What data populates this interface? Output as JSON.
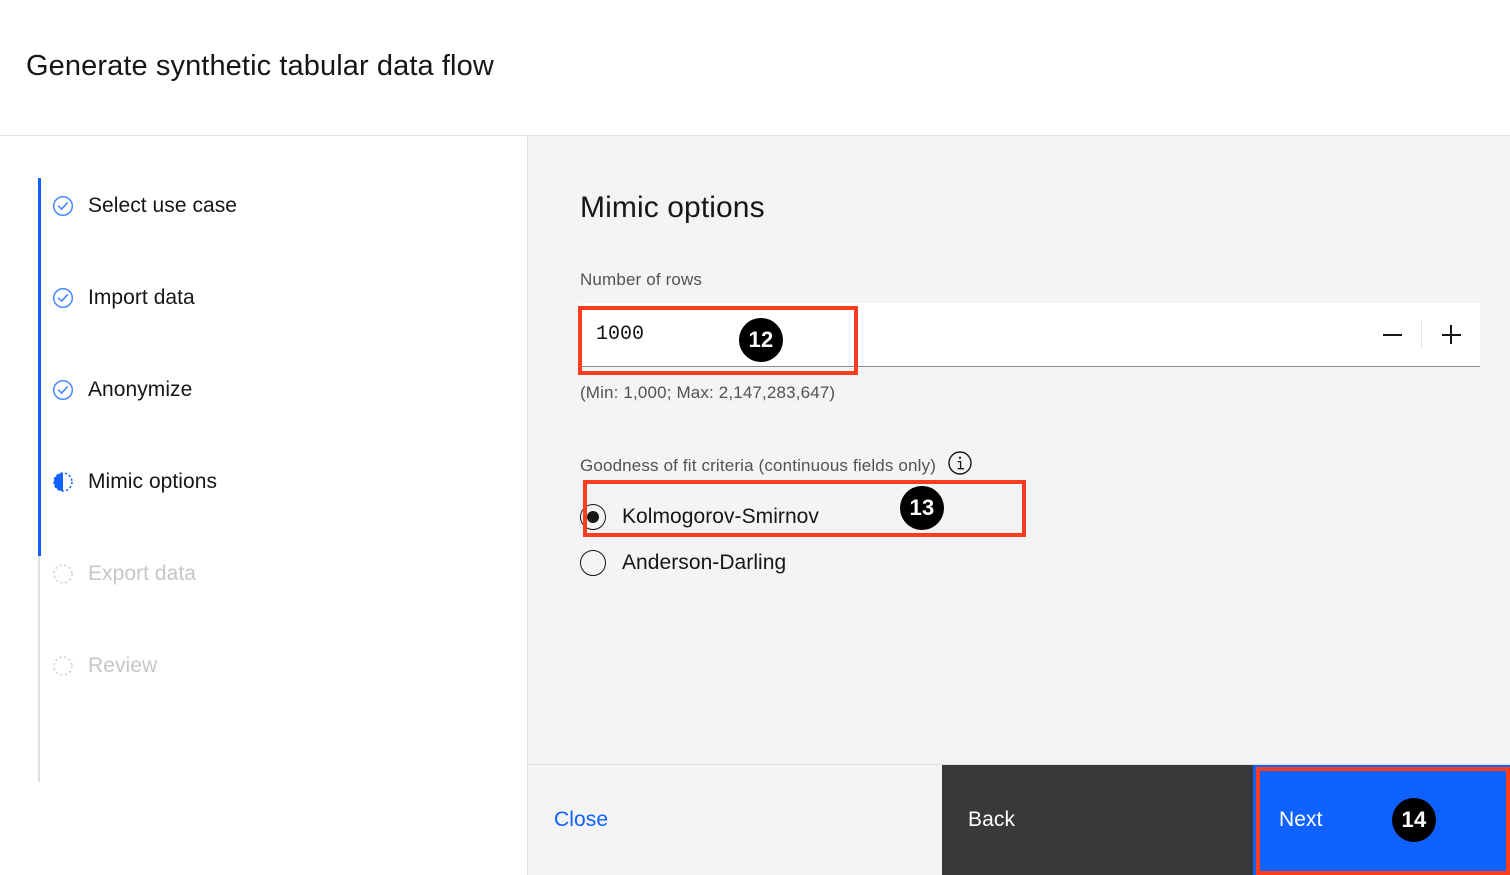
{
  "header": {
    "title": "Generate synthetic tabular data flow"
  },
  "sidebar": {
    "steps": [
      {
        "label": "Select use case",
        "state": "complete",
        "icon": "check-circle-icon"
      },
      {
        "label": "Import data",
        "state": "complete",
        "icon": "check-circle-icon"
      },
      {
        "label": "Anonymize",
        "state": "complete",
        "icon": "check-circle-icon"
      },
      {
        "label": "Mimic options",
        "state": "current",
        "icon": "half-filled-circle-icon"
      },
      {
        "label": "Export data",
        "state": "disabled",
        "icon": "dashed-circle-icon"
      },
      {
        "label": "Review",
        "state": "disabled",
        "icon": "dashed-circle-icon"
      }
    ]
  },
  "main": {
    "section_title": "Mimic options",
    "number_of_rows": {
      "label": "Number of rows",
      "value": "1000",
      "placeholder": "",
      "helper_text": "(Min: 1,000; Max: 2,147,283,647)",
      "decrement_icon": "minus-icon",
      "increment_icon": "plus-icon"
    },
    "goodness_of_fit": {
      "legend": "Goodness of fit criteria (continuous fields only)",
      "info_icon": "information-icon",
      "selected": "Kolmogorov-Smirnov",
      "options": [
        {
          "label": "Kolmogorov-Smirnov",
          "checked": true
        },
        {
          "label": "Anderson-Darling",
          "checked": false
        }
      ]
    }
  },
  "footer": {
    "close_label": "Close",
    "back_label": "Back",
    "next_label": "Next"
  },
  "annotations": [
    {
      "number": "12",
      "target": "number-of-rows-input"
    },
    {
      "number": "13",
      "target": "radio-kolmogorov-smirnov"
    },
    {
      "number": "14",
      "target": "next-button"
    }
  ],
  "colors": {
    "accent_blue": "#0f62fe",
    "annotation_red": "#f93d1e",
    "back_dark": "#393939",
    "panel_gray": "#f4f4f4",
    "text_primary": "#161616",
    "text_secondary": "#525252",
    "text_disabled": "#c6c6c6"
  }
}
